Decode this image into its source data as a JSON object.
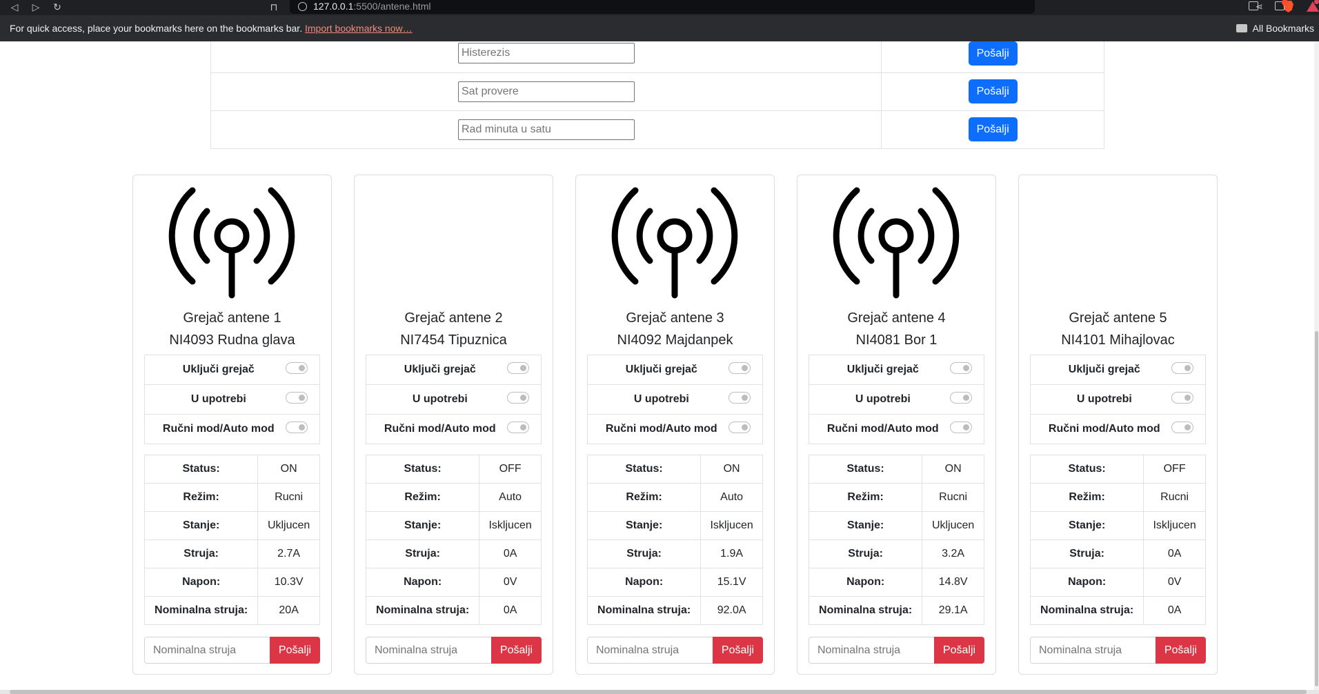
{
  "browser": {
    "url_host": "127.0.0.1",
    "url_rest": ":5500/antene.html",
    "bookmarks_prompt": "For quick access, place your bookmarks here on the bookmarks bar.",
    "import_link": "Import bookmarks now…",
    "all_bookmarks": "All Bookmarks"
  },
  "settings": {
    "rows": [
      {
        "placeholder": "Histerezis",
        "button": "Pošalji"
      },
      {
        "placeholder": "Sat provere",
        "button": "Pošalji"
      },
      {
        "placeholder": "Rad minuta u satu",
        "button": "Pošalji"
      }
    ]
  },
  "toggle_labels": [
    "Uključi grejač",
    "U upotrebi",
    "Ručni mod/Auto mod"
  ],
  "stat_labels": [
    "Status:",
    "Režim:",
    "Stanje:",
    "Struja:",
    "Napon:",
    "Nominalna struja:"
  ],
  "nominal_placeholder": "Nominalna struja",
  "send_label": "Pošalji",
  "antennas": [
    {
      "title": "Grejač antene 1",
      "subtitle": "NI4093 Rudna glava",
      "icon": "antenna-icon",
      "icon_visible": true,
      "stats": [
        "ON",
        "Rucni",
        "Ukljucen",
        "2.7A",
        "10.3V",
        "20A"
      ]
    },
    {
      "title": "Grejač antene 2",
      "subtitle": "NI7454 Tipuznica",
      "icon": "antenna-icon",
      "icon_visible": false,
      "stats": [
        "OFF",
        "Auto",
        "Iskljucen",
        "0A",
        "0V",
        "0A"
      ]
    },
    {
      "title": "Grejač antene 3",
      "subtitle": "NI4092 Majdanpek",
      "icon": "antenna-icon",
      "icon_visible": true,
      "stats": [
        "ON",
        "Auto",
        "Iskljucen",
        "1.9A",
        "15.1V",
        "92.0A"
      ]
    },
    {
      "title": "Grejač antene 4",
      "subtitle": "NI4081 Bor 1",
      "icon": "antenna-icon",
      "icon_visible": true,
      "stats": [
        "ON",
        "Rucni",
        "Ukljucen",
        "3.2A",
        "14.8V",
        "29.1A"
      ]
    },
    {
      "title": "Grejač antene 5",
      "subtitle": "NI4101 Mihajlovac",
      "icon": "antenna-icon",
      "icon_visible": false,
      "stats": [
        "OFF",
        "Rucni",
        "Iskljucen",
        "0A",
        "0V",
        "0A"
      ]
    }
  ]
}
